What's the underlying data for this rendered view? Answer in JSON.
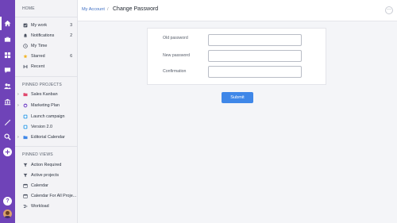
{
  "sidebar": {
    "home_title": "HOME",
    "home_items": [
      {
        "label": "My work",
        "count": "3",
        "icon": "check-square-icon"
      },
      {
        "label": "Notifications",
        "count": "2",
        "icon": "bell-icon"
      },
      {
        "label": "My Time",
        "count": "",
        "icon": "clock-icon"
      },
      {
        "label": "Starred",
        "count": "6",
        "icon": "star-icon"
      },
      {
        "label": "Recent",
        "count": "",
        "icon": "history-icon"
      }
    ],
    "projects_title": "PINNED PROJECTS",
    "projects": [
      {
        "label": "Sales Kanban",
        "icon": "folder-icon",
        "color": "#e0486e"
      },
      {
        "label": "Marketing Plan",
        "icon": "folder-icon",
        "color": "#7b4fc9"
      },
      {
        "label": "Launch campaign",
        "icon": "project-icon",
        "color": "#3aa0e8"
      },
      {
        "label": "Version 2.0",
        "icon": "project-icon",
        "color": "#3aa0e8"
      },
      {
        "label": "Editorial Calendar",
        "icon": "folder-icon",
        "color": "#3f87e8"
      }
    ],
    "views_title": "PINNED VIEWS",
    "views": [
      {
        "label": "Action Required",
        "icon": "filter-icon"
      },
      {
        "label": "Active projects",
        "icon": "filter-icon"
      },
      {
        "label": "Calendar",
        "icon": "calendar-icon"
      },
      {
        "label": "Calendar For All Proje...",
        "icon": "calendar-icon"
      },
      {
        "label": "Workload",
        "icon": "workload-icon"
      }
    ]
  },
  "header": {
    "breadcrumb": "My Account",
    "separator": "/",
    "title": "Change Password"
  },
  "form": {
    "old_password_label": "Old password",
    "new_password_label": "New password",
    "confirmation_label": "Confirmation",
    "old_password_value": "",
    "new_password_value": "",
    "confirmation_value": "",
    "submit_label": "Submit"
  },
  "colors": {
    "rail": "#6f43b8",
    "accent": "#3f87e8",
    "link": "#3e6fc4"
  }
}
